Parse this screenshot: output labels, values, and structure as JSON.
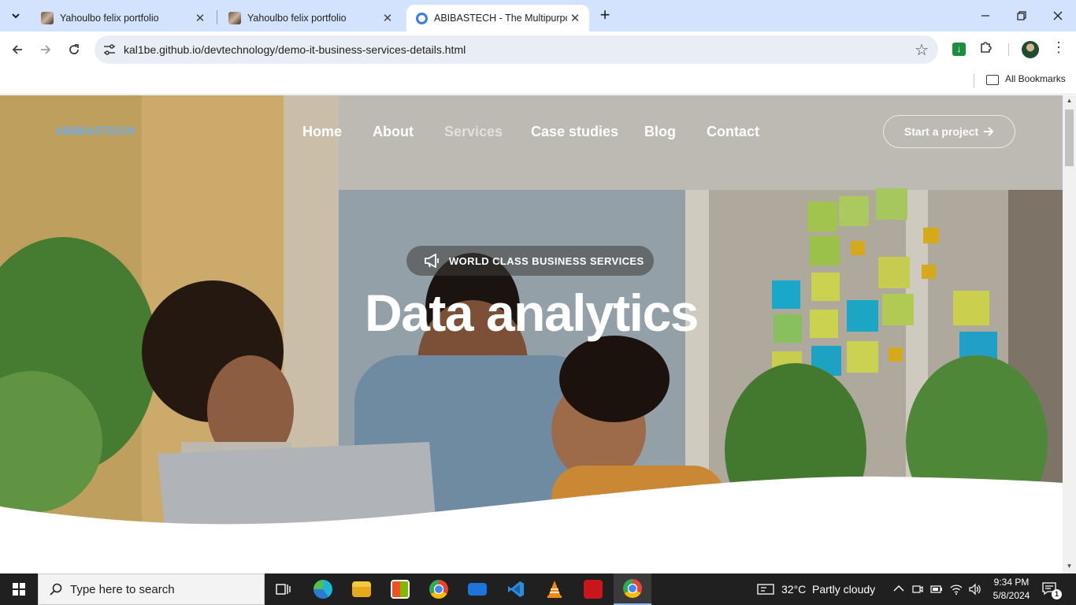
{
  "browser": {
    "tabs": [
      {
        "title": "Yahoulbo felix portfolio",
        "active": false
      },
      {
        "title": "Yahoulbo felix portfolio",
        "active": false
      },
      {
        "title": "ABIBASTECH - The Multipurpos",
        "active": true
      }
    ],
    "url": "kal1be.github.io/devtechnology/demo-it-business-services-details.html",
    "bookmarks_label": "All Bookmarks"
  },
  "site": {
    "logo": "ABIBASTECH",
    "nav": [
      {
        "label": "Home",
        "active": false
      },
      {
        "label": "About",
        "active": false
      },
      {
        "label": "Services",
        "active": true
      },
      {
        "label": "Case studies",
        "active": false
      },
      {
        "label": "Blog",
        "active": false
      },
      {
        "label": "Contact",
        "active": false
      }
    ],
    "cta_label": "Start a project",
    "badge": "WORLD CLASS BUSINESS SERVICES",
    "hero_title": "Data analytics"
  },
  "taskbar": {
    "search_placeholder": "Type here to search",
    "weather_temp": "32°C",
    "weather_desc": "Partly cloudy",
    "time": "9:34 PM",
    "date": "5/8/2024",
    "notification_count": "1"
  },
  "colors": {
    "logo": "#6ab0f0",
    "tabstrip": "#d3e3fd",
    "taskbar": "#202020"
  }
}
